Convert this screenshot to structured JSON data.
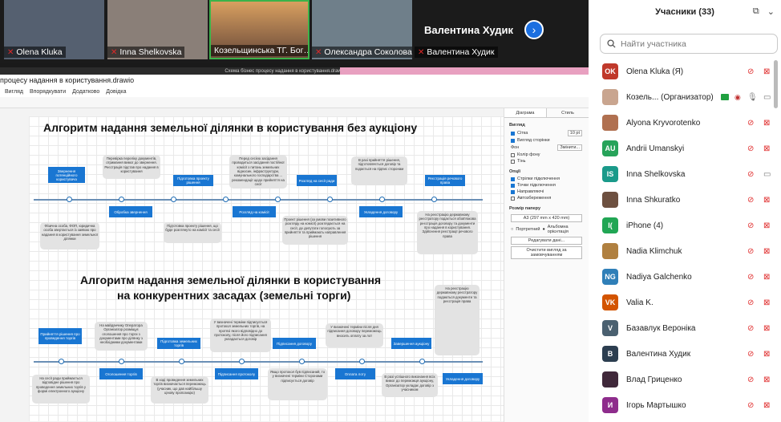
{
  "video_tiles": [
    {
      "name": "Olena Kluka",
      "bg": "#556070"
    },
    {
      "name": "Inna Shelkovska",
      "bg": "#7a6e66"
    },
    {
      "name": "Козельщинська ТГ. Бог…",
      "bg": "#c48a55"
    },
    {
      "name": "Олександра Соколова",
      "bg": "#6f7f8a"
    },
    {
      "name": "Валентина Худик",
      "bg": "#1b1b1b"
    }
  ],
  "featured_name": "Валентина Худик",
  "share": {
    "title_bar": "Схема бізнес процесу надання в користування.drawio - diagr...",
    "app_title": "процесу надання в користування.drawio",
    "menu": [
      "Вигляд",
      "Впорядкувати",
      "Додатково",
      "Довідка"
    ],
    "diagram1": {
      "title": "Алгоритм надання земельної ділянки в користування без аукціону",
      "top_blue": [
        "Звернення потенційного користувача",
        "Підготовка проекту рішення",
        "Розгляд на сесії ради",
        "Реєстрація речового права"
      ],
      "top_grey": [
        "Перевірка переліку документів, отримання вимог до звернення. Реєстрація підстав про надання в користування",
        "Перед сесією засідання проводиться засідання постійної комісії з питань земельних відносин, інфраструктури, комунального господарства ... рекомендації щодо прийняття на сесії",
        "В разі прийняття рішення, підготовляється договір та подається на підпис сторонам"
      ],
      "bot_blue": [
        "Обробка звернення",
        "Розгляд на комісії",
        "Укладення договору"
      ],
      "bot_grey": [
        "Фізична особа, ФОП, юридична особа звертається із заявою про надання в користування земельної ділянки",
        "Підготовка проекту рішення, що буде розглянуто на комісії та сесії",
        "Проект рішення (за умови позитивного розгляду на комісії) розглядається на сесії, де депутати голосують за прийняття та приймають направлення рішення",
        "На реєстрацію державному реєстратору подається обов'язкова реєстрація договору та документи про надання в користування. Здійснення реєстрації речового права"
      ]
    },
    "diagram2": {
      "title_line1": "Алгоритм надання земельної ділянки в користування",
      "title_line2": "на конкурентних засадах (земельні торги)",
      "top_blue": [
        "Прийняття рішення про проведення торгів",
        "Підготовка земельних торгів",
        "Підписання договору",
        "Завершення аукціону",
        "Укладення договору"
      ],
      "top_grey": [
        "На майданчику Оператора Організатор розміщує оголошення про торги з документами про ділянку з необхідними документами",
        "У визначені терміни підписується протокол земельних торгів, на протязі якого відповідно до протоколу, після його підписання укладається договір",
        "У визначені терміни після дня підписання договору переможець вносить оплату за лот",
        "На реєстрацію державному реєстратору подаються документи та реєстрація права"
      ],
      "bot_blue": [
        "Оголошення торгів",
        "Підписання протоколу",
        "Оплата лоту"
      ],
      "bot_grey": [
        "На сесії ради приймається відповідне рішення про проведення земельних торгів у формі електронного аукціону",
        "В ході проведення земельних торгів визначається переможець (учасник, що дав найбільшу цінову пропозицію)",
        "Якщо протокол був підписаний, то у визначені терміни Сторонами підписується договір",
        "В разі успішного виконання всіх вимог до переможця аукціону, Організатор укладає договір з учасником"
      ]
    },
    "right_panel": {
      "tabs": [
        "Діаграма",
        "Стиль"
      ],
      "sec_view": "Вигляд",
      "grid": "Сітка",
      "grid_val": "10 pt",
      "page_view": "Вигляд сторінки",
      "bg": "Фон",
      "bg_btn": "Змінити...",
      "shadow": "Тінь",
      "font_color": "Колір фону",
      "sec_options": "Опції",
      "opts": [
        "Стрілки підключення",
        "Точки підключення",
        "Направляючі",
        "Автозбереження"
      ],
      "paper_size": "Розмір паперу",
      "paper_val": "A3 (297 mm x 420 mm)",
      "portrait": "Портретний",
      "landscape": "Альбомна орієнтація",
      "btn_edit": "Редагувати дані...",
      "btn_clear": "Очистити вигляд за замовчуванням"
    }
  },
  "panel": {
    "title": "Учасники (33)",
    "search_placeholder": "Найти участника",
    "participants": [
      {
        "name": "Olena Kluka (Я)",
        "initials": "OK",
        "color": "#c0392b"
      },
      {
        "name": "Козель... (Организатор)",
        "initials": "",
        "color": "#c9a58f"
      },
      {
        "name": "Alyona Kryvorotenko",
        "initials": "",
        "color": "#b07050"
      },
      {
        "name": "Andrii Umanskyi",
        "initials": "AU",
        "color": "#27a35a"
      },
      {
        "name": "Inna Shelkovska",
        "initials": "IS",
        "color": "#1a9a8a"
      },
      {
        "name": "Inna Shkuratko",
        "initials": "",
        "color": "#6d5040"
      },
      {
        "name": "iPhone (4)",
        "initials": "I(",
        "color": "#21a654"
      },
      {
        "name": "Nadia Klimchuk",
        "initials": "",
        "color": "#b08040"
      },
      {
        "name": "Nadiya Galchenko",
        "initials": "NG",
        "color": "#2f7fb8"
      },
      {
        "name": "Valia K.",
        "initials": "VK",
        "color": "#d35400"
      },
      {
        "name": "Базавлук Вероніка",
        "initials": "V",
        "color": "#4a6070"
      },
      {
        "name": "Валентина Худик",
        "initials": "В",
        "color": "#2c3e50"
      },
      {
        "name": "Влад Гриценко",
        "initials": "",
        "color": "#40283a"
      },
      {
        "name": "Ігорь Мартышко",
        "initials": "И",
        "color": "#8e2c8c"
      }
    ]
  }
}
